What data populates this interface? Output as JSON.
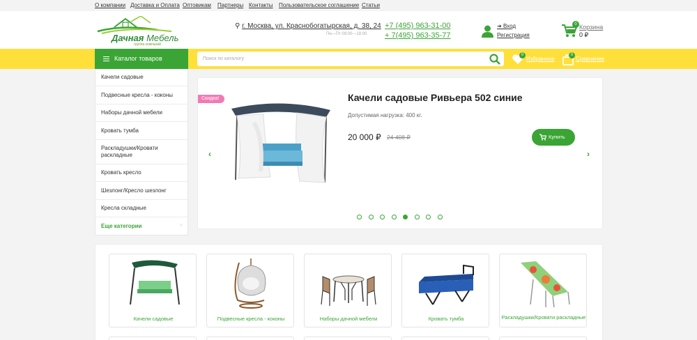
{
  "top_nav": [
    "О компании",
    "Доставка и Оплата",
    "Оптовикам",
    "Партнеры",
    "Контакты",
    "Пользовательское соглашение",
    "Статьи"
  ],
  "logo": {
    "name_bold": "Дачная",
    "name_light": " Мебель",
    "tagline": "группа компаний"
  },
  "contacts": {
    "address": "г. Москва, ул. Краснобогатырская, д. 38, 24",
    "hours": "Пн—Пт 09:00—18:00",
    "phone1": "+7 (495) 963-31-00",
    "phone2": "+ 7(495) 963-35-77"
  },
  "account": {
    "login": "Вход",
    "register": "Регистрация"
  },
  "cart": {
    "label": "Корзина",
    "count": "0",
    "total": "0 ₽"
  },
  "toolbar": {
    "catalog_label": "Каталог товаров",
    "search_placeholder": "Поиск по каталогу",
    "favorites_label": "Избранное",
    "favorites_count": "0",
    "compare_label": "Сравнение",
    "compare_count": "0"
  },
  "side_menu": {
    "items": [
      "Качели садовые",
      "Подвесные кресла - коконы",
      "Наборы дачной мебели",
      "Кровать тумба",
      "Раскладушки/Кровати раскладные",
      "Кровать кресло",
      "Шезлонг/Кресло шезлонг",
      "Кресла складные"
    ],
    "more": "Еще категории"
  },
  "slider": {
    "badge": "Скидка!",
    "title": "Качели садовые Ривьера 502 синие",
    "load": "Допустимая нагрузка: 400 кг.",
    "price": "20 000 ₽",
    "old_price": "24 408 ₽",
    "buy_label": "Купить",
    "slide_count": 8,
    "active_slide": 5
  },
  "categories": [
    "Качели садовые",
    "Подвесные кресла - коконы",
    "Наборы дачной мебели",
    "Кровать тумба",
    "Раскладушки/Кровати раскладные"
  ],
  "colors": {
    "green": "#3aa535",
    "yellow": "#ffe03a",
    "pink": "#f27ab4"
  }
}
